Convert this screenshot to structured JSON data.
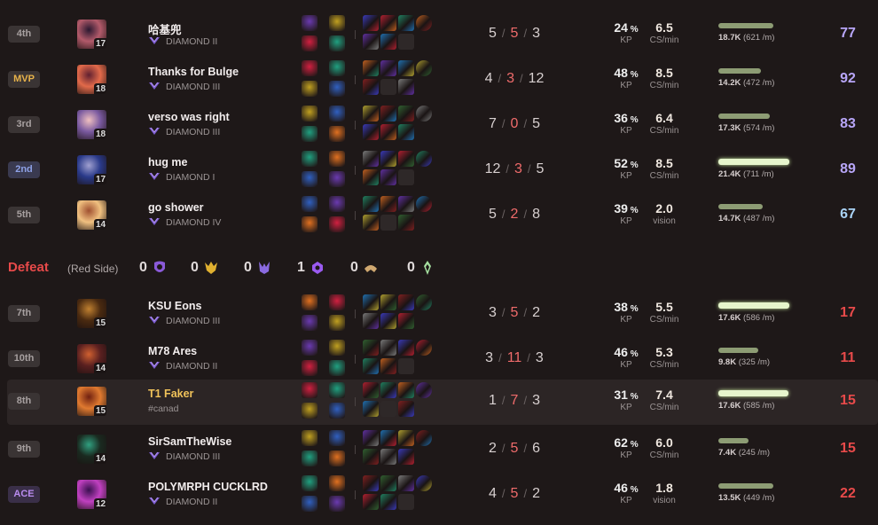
{
  "colors": {
    "background": "#1e1818",
    "defeat": "#e84a4a",
    "deaths": "#ef6b6b",
    "score_blue_high": "#b8a6f8",
    "score_blue_mid": "#a9d2f5",
    "score_red": "#e84a4a",
    "player_highlight_name": "#f0c25a",
    "damage_bar": "#8d9c74",
    "damage_bar_top": "#e6f5cc"
  },
  "blue_team": [
    {
      "rank": "4th",
      "champion_level": "17",
      "name": "哈基兜",
      "tier": "DIAMOND II",
      "kills": "5",
      "deaths": "5",
      "assists": "3",
      "kp": "24",
      "kp_label": "KP",
      "cs": "6.5",
      "cs_label": "CS/min",
      "damage": "18.7K",
      "dpm": "(621 /m)",
      "damage_share": 0.78,
      "score": "77"
    },
    {
      "rank": "MVP",
      "champion_level": "18",
      "name": "Thanks for Bulge",
      "tier": "DIAMOND III",
      "kills": "4",
      "deaths": "3",
      "assists": "12",
      "kp": "48",
      "kp_label": "KP",
      "cs": "8.5",
      "cs_label": "CS/min",
      "damage": "14.2K",
      "dpm": "(472 /m)",
      "damage_share": 0.6,
      "score": "92"
    },
    {
      "rank": "3rd",
      "champion_level": "18",
      "name": "verso was right",
      "tier": "DIAMOND III",
      "kills": "7",
      "deaths": "0",
      "assists": "5",
      "kp": "36",
      "kp_label": "KP",
      "cs": "6.4",
      "cs_label": "CS/min",
      "damage": "17.3K",
      "dpm": "(574 /m)",
      "damage_share": 0.72,
      "score": "83"
    },
    {
      "rank": "2nd",
      "champion_level": "17",
      "name": "hug me",
      "tier": "DIAMOND I",
      "kills": "12",
      "deaths": "3",
      "assists": "5",
      "kp": "52",
      "kp_label": "KP",
      "cs": "8.5",
      "cs_label": "CS/min",
      "damage": "21.4K",
      "dpm": "(711 /m)",
      "damage_share": 1.0,
      "score": "89"
    },
    {
      "rank": "5th",
      "champion_level": "14",
      "name": "go shower",
      "tier": "DIAMOND IV",
      "kills": "5",
      "deaths": "2",
      "assists": "8",
      "kp": "39",
      "kp_label": "KP",
      "cs": "2.0",
      "cs_label": "vision",
      "damage": "14.7K",
      "dpm": "(487 /m)",
      "damage_share": 0.62,
      "score": "67"
    }
  ],
  "red_team_header": {
    "result": "Defeat",
    "side": "(Red Side)",
    "objectives": [
      {
        "name": "baron-icon",
        "count": "0"
      },
      {
        "name": "dragon-icon",
        "count": "0"
      },
      {
        "name": "herald-icon",
        "count": "0"
      },
      {
        "name": "voidgrub-icon",
        "count": "1"
      },
      {
        "name": "tower-icon",
        "count": "0"
      },
      {
        "name": "inhibitor-icon",
        "count": "0"
      }
    ]
  },
  "red_team": [
    {
      "rank": "7th",
      "champion_level": "15",
      "name": "KSU Eons",
      "tier": "DIAMOND III",
      "kills": "3",
      "deaths": "5",
      "assists": "2",
      "kp": "38",
      "kp_label": "KP",
      "cs": "5.5",
      "cs_label": "CS/min",
      "damage": "17.6K",
      "dpm": "(586 /m)",
      "damage_share": 1.0,
      "score": "17"
    },
    {
      "rank": "10th",
      "champion_level": "14",
      "name": "M78 Ares",
      "tier": "DIAMOND II",
      "kills": "3",
      "deaths": "11",
      "assists": "3",
      "kp": "46",
      "kp_label": "KP",
      "cs": "5.3",
      "cs_label": "CS/min",
      "damage": "9.8K",
      "dpm": "(325 /m)",
      "damage_share": 0.56,
      "score": "11"
    },
    {
      "rank": "8th",
      "champion_level": "15",
      "name": "T1 Faker",
      "tier": "#canad",
      "kills": "1",
      "deaths": "7",
      "assists": "3",
      "kp": "31",
      "kp_label": "KP",
      "cs": "7.4",
      "cs_label": "CS/min",
      "damage": "17.6K",
      "dpm": "(585 /m)",
      "damage_share": 0.99,
      "score": "15",
      "highlight": true
    },
    {
      "rank": "9th",
      "champion_level": "14",
      "name": "SirSamTheWise",
      "tier": "DIAMOND III",
      "kills": "2",
      "deaths": "5",
      "assists": "6",
      "kp": "62",
      "kp_label": "KP",
      "cs": "6.0",
      "cs_label": "CS/min",
      "damage": "7.4K",
      "dpm": "(245 /m)",
      "damage_share": 0.42,
      "score": "15"
    },
    {
      "rank": "ACE",
      "champion_level": "12",
      "name": "POLYMRPH CUCKLRD",
      "tier": "DIAMOND II",
      "kills": "4",
      "deaths": "5",
      "assists": "2",
      "kp": "46",
      "kp_label": "KP",
      "cs": "1.8",
      "cs_label": "vision",
      "damage": "13.5K",
      "dpm": "(449 /m)",
      "damage_share": 0.77,
      "score": "22"
    }
  ]
}
